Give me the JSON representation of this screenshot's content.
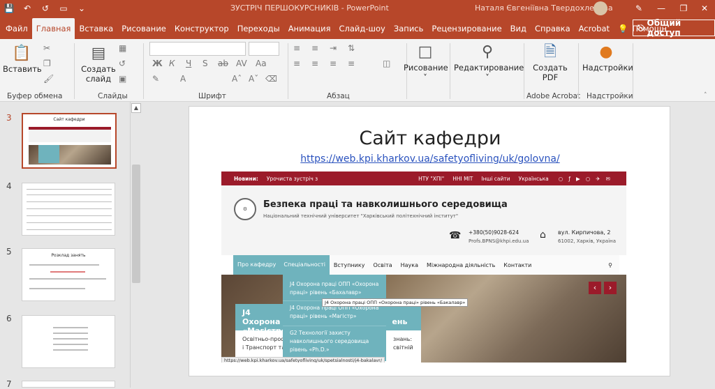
{
  "titlebar": {
    "title": "ЗУСТРІЧ ПЕРШОКУРСНИКІВ  -  PowerPoint",
    "user": "Наталя Євгеніївна Твердохлебова"
  },
  "tabs": [
    "Файл",
    "Главная",
    "Вставка",
    "Рисование",
    "Конструктор",
    "Переходы",
    "Анимация",
    "Слайд-шоу",
    "Запись",
    "Рецензирование",
    "Вид",
    "Справка",
    "Acrobat",
    "Помощн"
  ],
  "share_label": "Общий доступ",
  "ribbon": {
    "paste": "Вставить",
    "new_slide_1": "Создать",
    "new_slide_2": "слайд",
    "drawing": "Рисование",
    "editing": "Редактирование",
    "create_pdf_1": "Создать",
    "create_pdf_2": "PDF",
    "settings": "Надстройки",
    "groups": {
      "clipboard": "Буфер обмена",
      "slides": "Слайды",
      "font": "Шрифт",
      "paragraph": "Абзац",
      "acrobat": "Adobe Acrobat",
      "addins": "Надстройки"
    },
    "font_buttons": [
      "Ж",
      "К",
      "Ч",
      "S",
      "ab",
      "AV",
      "Aa",
      "A"
    ]
  },
  "thumbnails": [
    {
      "num": "3",
      "selected": true,
      "title": "Сайт кафедри"
    },
    {
      "num": "4",
      "selected": false,
      "title": ""
    },
    {
      "num": "5",
      "selected": false,
      "title": "Розклад занять"
    },
    {
      "num": "6",
      "selected": false,
      "title": ""
    },
    {
      "num": "7",
      "selected": false,
      "title": ""
    }
  ],
  "slide": {
    "title": "Сайт кафедри",
    "link": "https://web.kpi.kharkov.ua/safetyofliving/uk/golovna/",
    "website": {
      "news_label": "Новини:",
      "news_text": "Урочиста зустріч з",
      "top_links": [
        "НТУ \"ХПІ\"",
        "ННІ МІТ",
        "Інші сайти",
        "Українська"
      ],
      "site_name": "Безпека праці та навколишнього середовища",
      "site_sub": "Національний технічний університет \"Харківський політехнічний інститут\"",
      "phone": "+380(50)9028-624",
      "email": "Profs.BPNS@khpi.edu.ua",
      "address": "вул. Кирпичова, 2",
      "city": "61002, Харків, Україна",
      "menu": [
        "Про кафедру",
        "Спеціальності",
        "Вступнику",
        "Освіта",
        "Наука",
        "Міжнародна діяльність",
        "Контакти"
      ],
      "dropdown": [
        "J4 Охорона праці ОПП «Охорона праці» рівень «Бахалавр»",
        "J4 Охорона праці ОПП «Охорона праці» рівень «Магістр»",
        "G2 Технології захисту навколишнього середовища рівень «Ph.D.»"
      ],
      "tooltip": "J4 Охорона праці ОПП «Охорона праці» рівень «Бакалавр»",
      "card_title_1": "J4 Охорона",
      "card_title_2": "«Магістр»",
      "card_title_suffix": "ень",
      "card_text_1": "Освітньо-проф",
      "card_text_2": "і Транспорт та",
      "card_text_3": "знань:",
      "card_text_4": "світній",
      "status_url": "https://web.kpi.kharkov.ua/safetyofliving/uk/spetsialnosti/j4-bakalavr/"
    }
  }
}
